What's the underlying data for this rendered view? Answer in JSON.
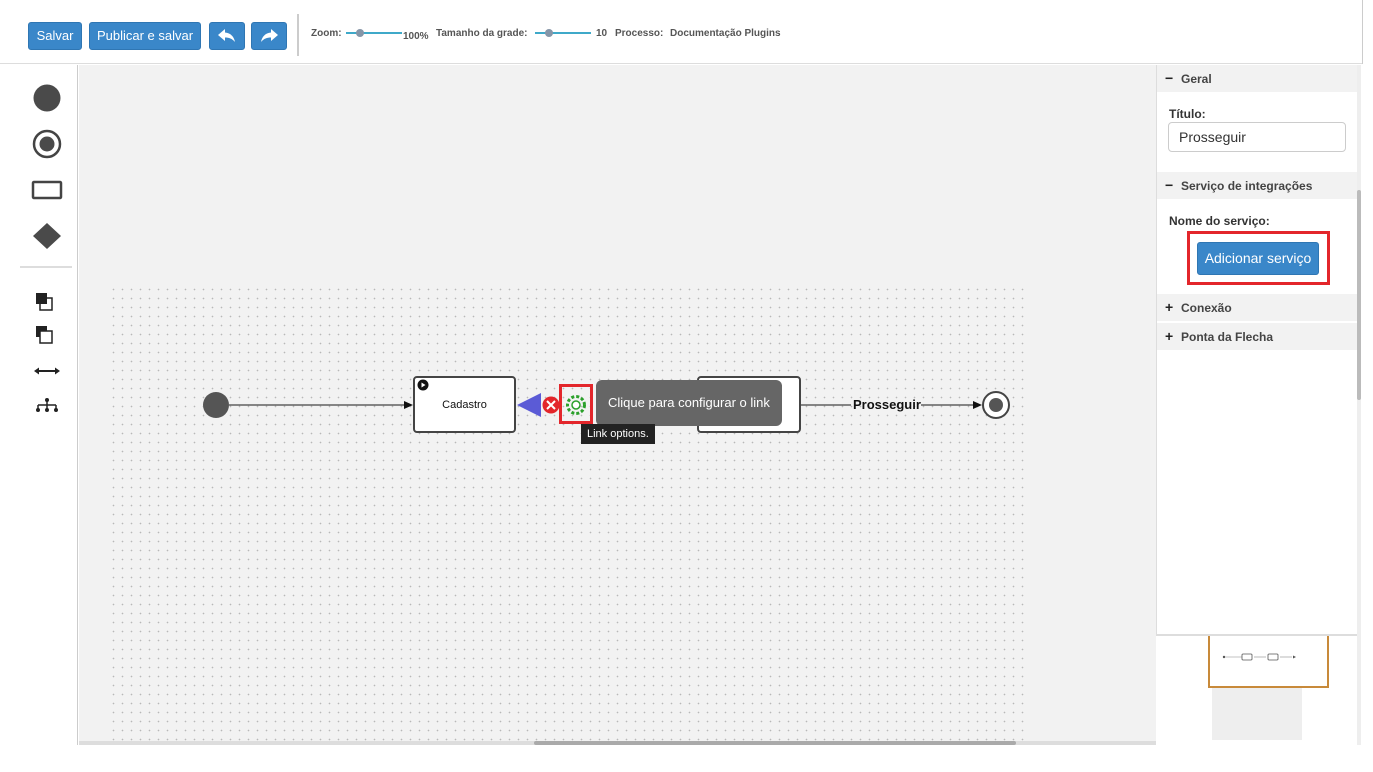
{
  "toolbar": {
    "save_label": "Salvar",
    "publish_label": "Publicar e salvar",
    "undo_icon": "undo-icon",
    "redo_icon": "redo-icon",
    "zoom_label": "Zoom:",
    "zoom_value": "100%",
    "grid_label": "Tamanho da grade:",
    "grid_value": "10",
    "process_label": "Processo:",
    "process_name": "Documentação Plugins",
    "accent_color": "#3a87c9"
  },
  "palette": {
    "items": [
      "start-event-icon",
      "end-event-icon",
      "task-icon",
      "gateway-icon",
      "bring-front-icon",
      "send-back-icon",
      "link-arrow-icon",
      "auto-layout-icon"
    ]
  },
  "canvas": {
    "task1": {
      "label": "Cadastro"
    },
    "tooltip_main": "Clique para configurar o link",
    "tooltip_small": "Link options.",
    "link_label": "Prosseguir"
  },
  "panel": {
    "sections": [
      {
        "sign": "−",
        "title": "Geral"
      },
      {
        "sign": "−",
        "title": "Serviço de integrações"
      },
      {
        "sign": "+",
        "title": "Conexão"
      },
      {
        "sign": "+",
        "title": "Ponta da Flecha"
      }
    ],
    "title_label": "Título:",
    "title_value": "Prosseguir",
    "service_label": "Nome do serviço:",
    "add_service_label": "Adicionar serviço"
  }
}
